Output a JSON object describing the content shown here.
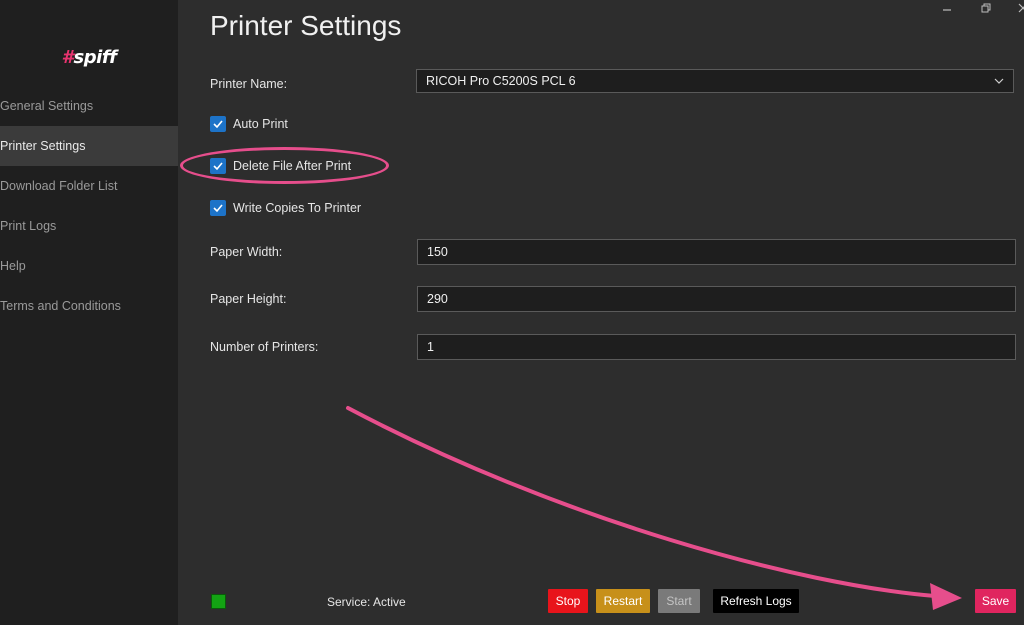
{
  "app": {
    "logo_hash": "#",
    "logo_word": "spiff"
  },
  "sidebar": {
    "items": [
      {
        "label": "General Settings",
        "active": false
      },
      {
        "label": "Printer Settings",
        "active": true
      },
      {
        "label": "Download Folder List",
        "active": false
      },
      {
        "label": "Print Logs",
        "active": false
      },
      {
        "label": "Help",
        "active": false
      },
      {
        "label": "Terms and Conditions",
        "active": false
      }
    ]
  },
  "window": {
    "minimize_icon": "minimize-icon",
    "restore_icon": "restore-icon",
    "close_icon": "close-icon"
  },
  "main": {
    "title": "Printer Settings",
    "printer_name": {
      "label": "Printer Name:",
      "value": "RICOH Pro C5200S PCL 6"
    },
    "checkboxes": [
      {
        "label": "Auto Print",
        "checked": true
      },
      {
        "label": "Delete File After Print",
        "checked": true
      },
      {
        "label": "Write Copies To Printer",
        "checked": true
      }
    ],
    "paper_width": {
      "label": "Paper Width:",
      "value": "150"
    },
    "paper_height": {
      "label": "Paper Height:",
      "value": "290"
    },
    "num_printers": {
      "label": "Number of Printers:",
      "value": "1"
    }
  },
  "footer": {
    "service_status": "Service: Active",
    "status_color": "#13a313",
    "buttons": {
      "stop": "Stop",
      "restart": "Restart",
      "start": "Start",
      "refresh_logs": "Refresh Logs",
      "save": "Save"
    },
    "colors": {
      "stop": "#e8141b",
      "restart": "#c7901a",
      "start": "#7a7a7a",
      "refresh": "#000000",
      "save": "#e0255f"
    }
  },
  "annotation": {
    "color": "#e64e8c"
  }
}
